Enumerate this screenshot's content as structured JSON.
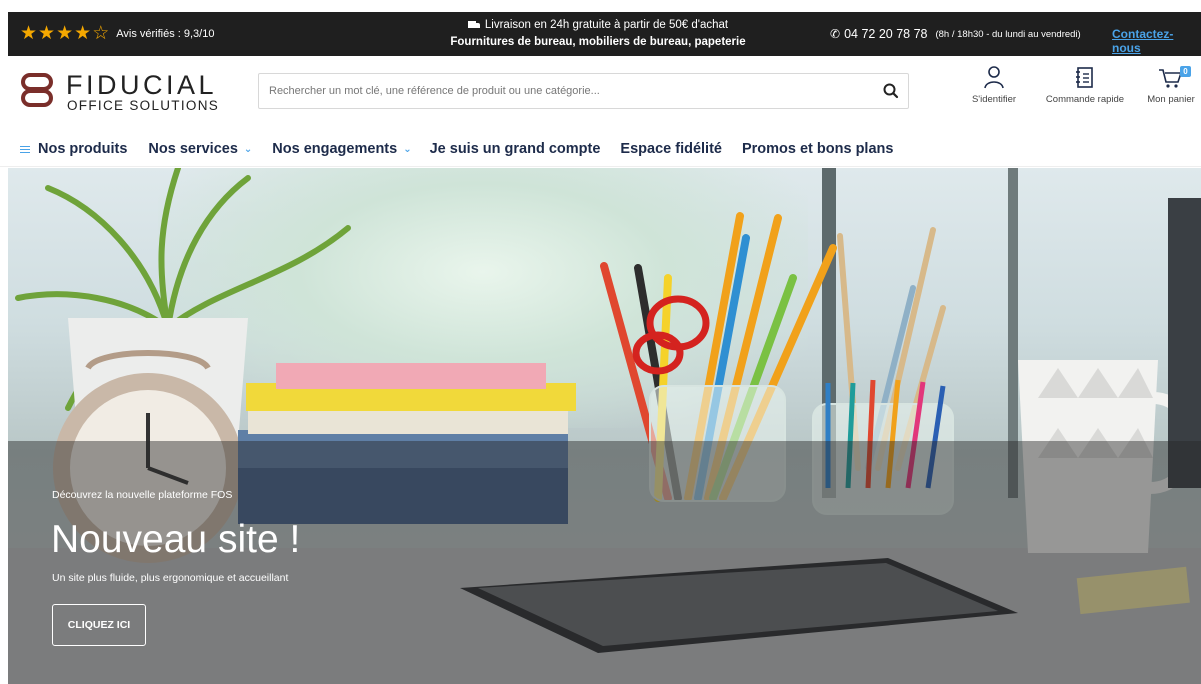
{
  "topbar": {
    "rating_stars": {
      "filled": 4,
      "total": 5
    },
    "reviews": "Avis vérifiés : 9,3/10",
    "promo_line1": "Livraison en 24h gratuite à partir de 50€ d'achat",
    "promo_line2": "Fournitures de bureau, mobiliers de bureau, papeterie",
    "phone": "04 72 20 78 78",
    "phone_hours": "(8h / 18h30 - du lundi au vendredi)",
    "contact_label": "Contactez-nous"
  },
  "header": {
    "logo_name": "FIDUCIAL",
    "logo_sub": "OFFICE SOLUTIONS",
    "search_placeholder": "Rechercher un mot clé, une référence de produit ou une catégorie...",
    "login_label": "S'identifier",
    "quick_order_label": "Commande rapide",
    "cart_label": "Mon panier",
    "cart_count": "0"
  },
  "nav": {
    "items": [
      {
        "label": "Nos produits"
      },
      {
        "label": "Nos services"
      },
      {
        "label": "Nos engagements"
      },
      {
        "label": "Je suis un grand compte"
      },
      {
        "label": "Espace fidélité"
      },
      {
        "label": "Promos et bons plans"
      }
    ]
  },
  "hero": {
    "kicker": "Découvrez la nouvelle plateforme FOS",
    "title": "Nouveau site !",
    "subtitle": "Un site plus fluide, plus ergonomique et accueillant",
    "cta": "CLIQUEZ ICI"
  },
  "colors": {
    "topbar_bg": "#1f1f1f",
    "star": "#f5a800",
    "accent_blue": "#4aa3e8",
    "logo_brown": "#7a2e2a",
    "nav_text": "#1d2b4a"
  }
}
